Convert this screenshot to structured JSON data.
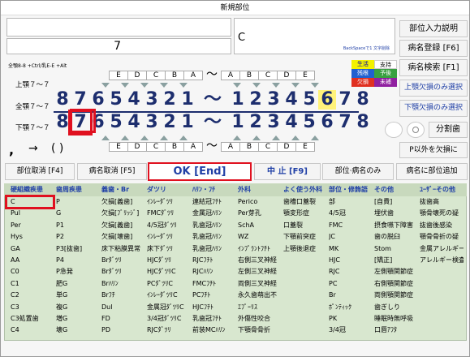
{
  "window": {
    "title": "新規部位"
  },
  "inputs": {
    "field2": "7",
    "field3": "C",
    "hint": "BackSpaceで1 文字削除"
  },
  "shortcuts": "全顎8-8 +Ctrl/乳E-E +Alt",
  "legend": {
    "c1": "生活",
    "c2": "支持",
    "c3": "残根",
    "c4": "予後",
    "c5": "欠損",
    "c6": "未補"
  },
  "side": {
    "b1": "部位入力説明",
    "b2": "病名登録 [F6]",
    "b3": "病名検索 [F1]",
    "b4": "上顎欠損のみ選択",
    "b5": "下顎欠損のみ選択",
    "b6": "分割歯",
    "b7": "P以外を欠損に"
  },
  "jaw": {
    "upper": "上顎７～７",
    "full": "全顎７～７",
    "lower": "下顎７～７"
  },
  "teeth": {
    "letters": [
      "E",
      "D",
      "C",
      "B",
      "A",
      "～",
      "A",
      "B",
      "C",
      "D",
      "E"
    ],
    "digits": [
      "8",
      "7",
      "6",
      "5",
      "4",
      "3",
      "2",
      "1",
      "～",
      "1",
      "2",
      "3",
      "4",
      "5",
      "6",
      "7",
      "8"
    ]
  },
  "symbols": {
    "comma": ",",
    "arrow": "→",
    "parens": "( )"
  },
  "actions": {
    "cancel_part": "部位取消 [F4]",
    "cancel_name": "病名取消 [F5]",
    "ok": "OK [End]",
    "stop": "中 止 [F9]",
    "part_name_only": "部位·病名のみ",
    "add_part": "病名に部位追加"
  },
  "table": {
    "headers": [
      "硬組織疾患",
      "歯周疾患",
      "義歯・Br",
      "ダツリ",
      "ﾊﾘﾝ・ﾌﾁ",
      "外科",
      "よく使う外科",
      "部位・修飾語",
      "その他",
      "ﾕｰｻﾞｰその他"
    ],
    "columns": [
      [
        "C",
        "Pul",
        "Per",
        "Hys",
        "GA",
        "AA",
        "C0",
        "C1",
        "C2",
        "C3",
        "C3処置歯",
        "C4"
      ],
      [
        "P",
        "G",
        "P1",
        "P2",
        "P3[抜歯]",
        "P4",
        "P急発",
        "肥G",
        "単G",
        "複G",
        "増G",
        "壊G"
      ],
      [
        "欠損[義歯]",
        "欠損[ﾌﾞﾘｯｼﾞ]",
        "欠損[義歯]",
        "欠損[壊歯]",
        "床下粘膜異常",
        "Brﾀﾞﾂﾘ",
        "Brﾀﾞﾂﾘ",
        "Brﾊﾘﾝ",
        "Brﾌﾁ",
        "Dul",
        "FD",
        "PD"
      ],
      [
        "ｲﾝﾚｰﾀﾞﾂﾘ",
        "FMCﾀﾞﾂﾘ",
        "4/5冠ﾀﾞﾂﾘ",
        "ｲﾝﾚｰﾀﾞﾂﾘ",
        "床下ﾀﾞﾂﾘ",
        "HJCﾀﾞﾂﾘ",
        "HJCﾀﾞﾂﾘC",
        "PCﾀﾞﾂﾘC",
        "ｲﾝﾚｰﾀﾞﾂﾘC",
        "金属冠ﾀﾞﾂﾘC",
        "3/4冠ﾀﾞﾂﾘC",
        "RJCﾀﾞﾂﾘ"
      ],
      [
        "連結冠ﾌﾁﾄ",
        "金属冠ﾊﾘﾝ",
        "乳歯冠ﾊﾘﾝ",
        "乳歯冠ﾊﾘﾝ",
        "乳歯冠ﾊﾘﾝ",
        "RJCﾌﾁﾄ",
        "RJCﾊﾘﾝ",
        "FMCﾌﾁﾄ",
        "PCﾌﾁﾄ",
        "HJCﾌﾁﾄ",
        "乳歯冠ﾌﾁﾄ",
        "前装MCﾊﾘﾝ"
      ],
      [
        "Perico",
        "Per芽孔",
        "SchA",
        "WZ",
        "ｲﾝﾌﾟﾗﾝﾄﾌﾁﾄ",
        "右側三叉神経",
        "左側三叉神経",
        "両側三叉神経",
        "永久歯萌出不",
        "ｴﾌﾟｰﾘｽ",
        "外傷性咬合",
        "下顎骨骨折"
      ],
      [
        "歯槽口蓋裂",
        "顎変形症",
        "口蓋裂",
        "下顎前突症",
        "上顎後退症",
        "",
        "",
        "",
        "",
        "",
        "",
        ""
      ],
      [
        "部",
        "4/5冠",
        "FMC",
        "JC",
        "MK",
        "HJC",
        "RJC",
        "PC",
        "Br",
        "ﾎﾟﾝﾃｨｯｸ",
        "PK",
        "3/4冠"
      ],
      [
        "[自費]",
        "埋伏歯",
        "摂食嚥下障害",
        "歯の脱臼",
        "Stom",
        "[矯正]",
        "左側顎関節症",
        "右側顎関節症",
        "両側顎関節症",
        "歯ぎしり",
        "睡眠時無呼吸",
        "口唇ｱﾌﾀ"
      ],
      [
        "抜歯高",
        "顎骨壊死の疑",
        "抜歯後感染",
        "顎骨骨折の疑",
        "金属アレルギー",
        "アレルギー検査",
        "",
        "",
        "",
        "",
        "",
        ""
      ]
    ]
  },
  "colors": {
    "accent": "#1f3fa6",
    "highlight_red": "#e0101f",
    "tooth_yellow": "#fff27a",
    "table_green": "#d8e7cf"
  }
}
